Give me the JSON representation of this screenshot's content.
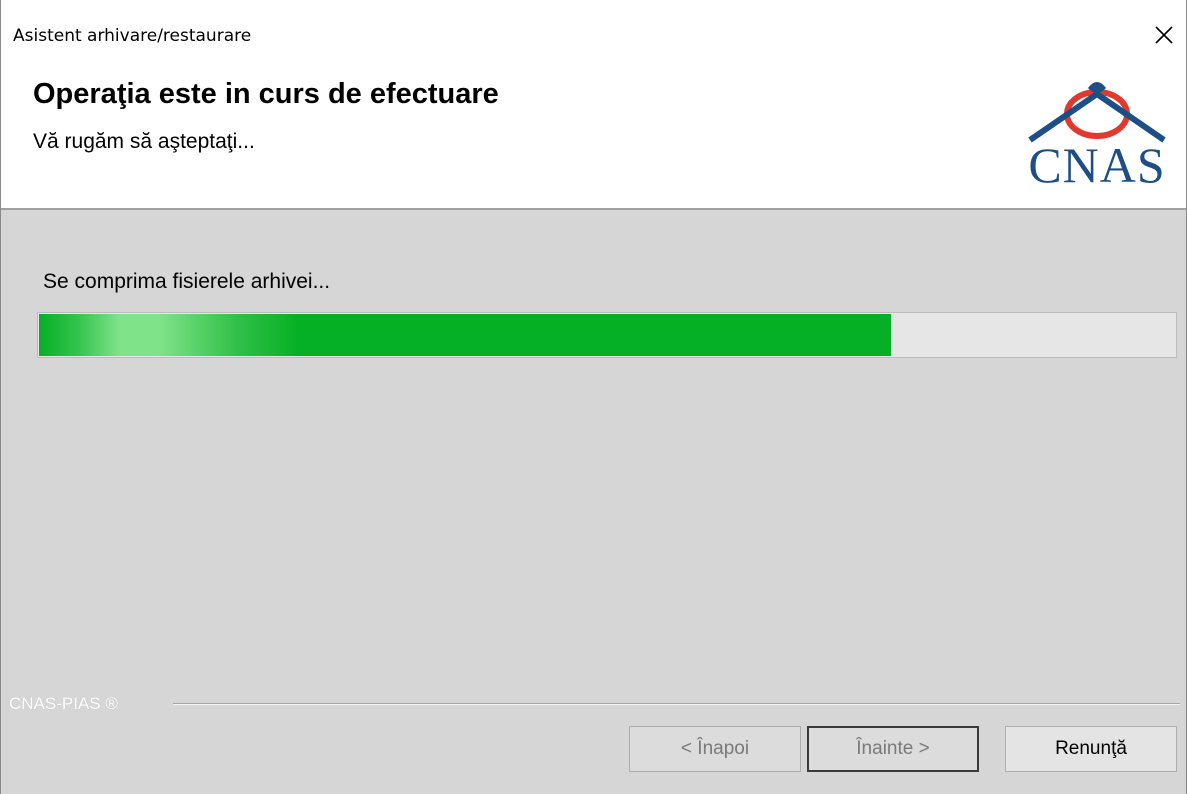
{
  "window": {
    "title": "Asistent arhivare/restaurare"
  },
  "header": {
    "title": "Operaţia este in curs de efectuare",
    "subtitle": "Vă rugăm să aşteptaţi...",
    "logo_text": "CNAS",
    "logo_colors": {
      "text": "#1d4f86",
      "arc": "#e03a2f"
    }
  },
  "main": {
    "status_text": "Se comprima fisierele arhivei...",
    "progress_fraction": 0.75,
    "progress_color": "#06b025"
  },
  "footer": {
    "brand_text": "CNAS-PIAS ®",
    "buttons": {
      "back_label": "< Înapoi",
      "next_label": "Înainte >",
      "cancel_label": "Renunţă"
    }
  },
  "icons": {
    "close": "close-icon"
  }
}
